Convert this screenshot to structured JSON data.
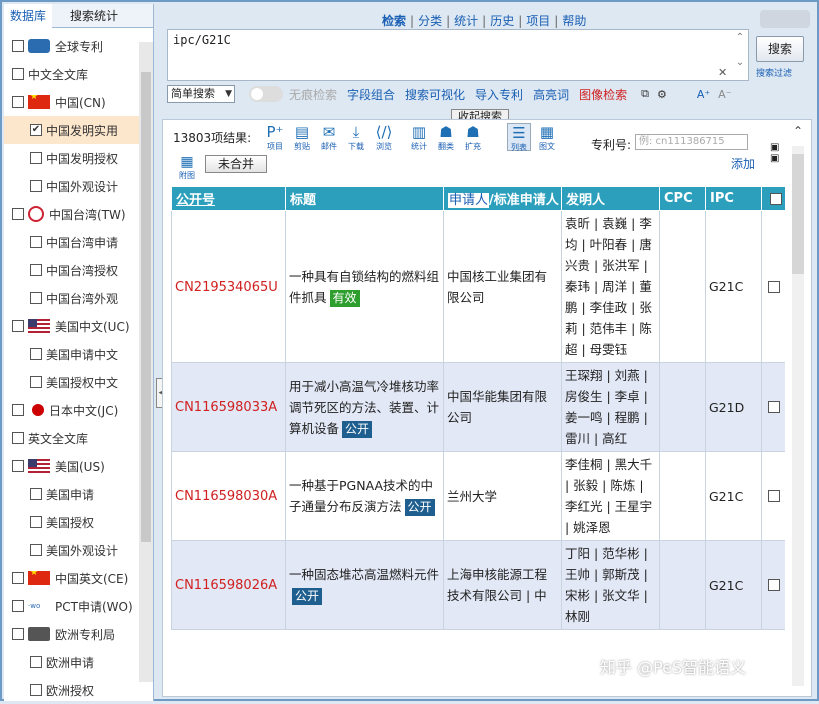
{
  "left_panel": {
    "tabs": [
      "数据库",
      "搜索统计"
    ],
    "items": [
      {
        "label": "全球专利",
        "checked": false,
        "flag": "globe",
        "sub": false
      },
      {
        "label": "中文全文库",
        "checked": false,
        "flag": "",
        "sub": false
      },
      {
        "label": "中国(CN)",
        "checked": false,
        "flag": "cn",
        "sub": false
      },
      {
        "label": "中国发明实用",
        "checked": true,
        "flag": "",
        "sub": true,
        "selected": true
      },
      {
        "label": "中国发明授权",
        "checked": false,
        "flag": "",
        "sub": true
      },
      {
        "label": "中国外观设计",
        "checked": false,
        "flag": "",
        "sub": true
      },
      {
        "label": "中国台湾(TW)",
        "checked": false,
        "flag": "tw",
        "sub": false
      },
      {
        "label": "中国台湾申请",
        "checked": false,
        "flag": "",
        "sub": true
      },
      {
        "label": "中国台湾授权",
        "checked": false,
        "flag": "",
        "sub": true
      },
      {
        "label": "中国台湾外观",
        "checked": false,
        "flag": "",
        "sub": true
      },
      {
        "label": "美国中文(UC)",
        "checked": false,
        "flag": "us",
        "sub": false
      },
      {
        "label": "美国申请中文",
        "checked": false,
        "flag": "",
        "sub": true
      },
      {
        "label": "美国授权中文",
        "checked": false,
        "flag": "",
        "sub": true
      },
      {
        "label": "日本中文(JC)",
        "checked": false,
        "flag": "jp",
        "sub": false
      },
      {
        "label": "英文全文库",
        "checked": false,
        "flag": "",
        "sub": false
      },
      {
        "label": "美国(US)",
        "checked": false,
        "flag": "us",
        "sub": false
      },
      {
        "label": "美国申请",
        "checked": false,
        "flag": "",
        "sub": true
      },
      {
        "label": "美国授权",
        "checked": false,
        "flag": "",
        "sub": true
      },
      {
        "label": "美国外观设计",
        "checked": false,
        "flag": "",
        "sub": true
      },
      {
        "label": "中国英文(CE)",
        "checked": false,
        "flag": "cn",
        "sub": false
      },
      {
        "label": "PCT申请(WO)",
        "checked": false,
        "flag": "wo",
        "sub": false
      },
      {
        "label": "欧洲专利局",
        "checked": false,
        "flag": "ep",
        "sub": false
      },
      {
        "label": "欧洲申请",
        "checked": false,
        "flag": "",
        "sub": true
      },
      {
        "label": "欧洲授权",
        "checked": false,
        "flag": "",
        "sub": true
      }
    ]
  },
  "topnav": {
    "items": [
      "检索",
      "分类",
      "统计",
      "历史",
      "项目",
      "帮助"
    ]
  },
  "search": {
    "query": "ipc/G21C",
    "button": "搜索",
    "filter": "搜索过滤",
    "clear": "✕",
    "mode": "简单搜索",
    "incognito": "无痕检索",
    "links": [
      "字段组合",
      "搜索可视化",
      "导入专利",
      "高亮词"
    ],
    "image_search": "图像检索",
    "font_up": "A⁺",
    "font_down": "A⁻",
    "collapse": "收起搜索"
  },
  "results": {
    "count_label": "13803项结果:",
    "tools": [
      {
        "label": "项目",
        "icon": "project-icon",
        "glyph": "P⁺"
      },
      {
        "label": "剪贴",
        "icon": "clip-icon",
        "glyph": "▤"
      },
      {
        "label": "邮件",
        "icon": "mail-icon",
        "glyph": "✉"
      },
      {
        "label": "下载",
        "icon": "download-icon",
        "glyph": "⤓"
      },
      {
        "label": "浏览",
        "icon": "browse-icon",
        "glyph": "⟨/⟩"
      },
      {
        "label": "统计",
        "icon": "stats-icon",
        "glyph": "▥"
      },
      {
        "label": "翻类",
        "icon": "group-icon",
        "glyph": "☗"
      },
      {
        "label": "扩充",
        "icon": "expand-icon",
        "glyph": "☗"
      },
      {
        "label": "列表",
        "icon": "list-icon",
        "glyph": "☰"
      },
      {
        "label": "图文",
        "icon": "grid-icon",
        "glyph": "▦"
      }
    ],
    "patent_no_label": "专利号:",
    "patent_no_placeholder": "例: cn111386715",
    "add": "添加",
    "attach_label": "附图",
    "merge": "未合并",
    "columns": [
      "公开号",
      "标题",
      "申请人",
      "/标准申请人",
      "发明人",
      "CPC",
      "IPC"
    ],
    "rows": [
      {
        "pub": "CN219534065U",
        "title": "一种具有自锁结构的燃料组件抓具",
        "status": "有效",
        "status_color": "green",
        "applicant": "中国核工业集团有限公司",
        "inventors": "袁昕 | 袁巍 | 李均 | 叶阳春 | 唐兴贵 | 张洪军 | 秦玮 | 周洋 | 董鹏 | 李佳政 | 张莉 | 范伟丰 | 陈超 | 母雯钰",
        "cpc": "",
        "ipc": "G21C"
      },
      {
        "pub": "CN116598033A",
        "title": "用于减小高温气冷堆核功率调节死区的方法、装置、计算机设备",
        "status": "公开",
        "status_color": "blue",
        "applicant": "中国华能集团有限公司",
        "inventors": "王琛翔 | 刘燕 | 房俊生 | 李卓 | 姜一鸣 | 程鹏 | 雷川 | 高红",
        "cpc": "",
        "ipc": "G21D"
      },
      {
        "pub": "CN116598030A",
        "title": "一种基于PGNAA技术的中子通量分布反演方法",
        "status": "公开",
        "status_color": "blue",
        "applicant": "兰州大学",
        "inventors": "李佳桐 | 黑大千 | 张毅 | 陈炼 | 李红光 | 王星宇 | 姚泽恩",
        "cpc": "",
        "ipc": "G21C"
      },
      {
        "pub": "CN116598026A",
        "title": "一种固态堆芯高温燃料元件",
        "status": "公开",
        "status_color": "blue",
        "applicant": "上海申核能源工程技术有限公司 | 中",
        "inventors": "丁阳 | 范华彬 | 王帅 | 郭斯茂 | 宋彬 | 张文华 | 林刚",
        "cpc": "",
        "ipc": "G21C"
      }
    ]
  },
  "watermark": "知乎 @PeS智能语义",
  "colors": {
    "header": "#2c9fbd",
    "pub_red": "#d02020",
    "link_blue": "#1a5fb4",
    "status_green": "#2e9e2e",
    "status_blue": "#1f5f8f"
  }
}
